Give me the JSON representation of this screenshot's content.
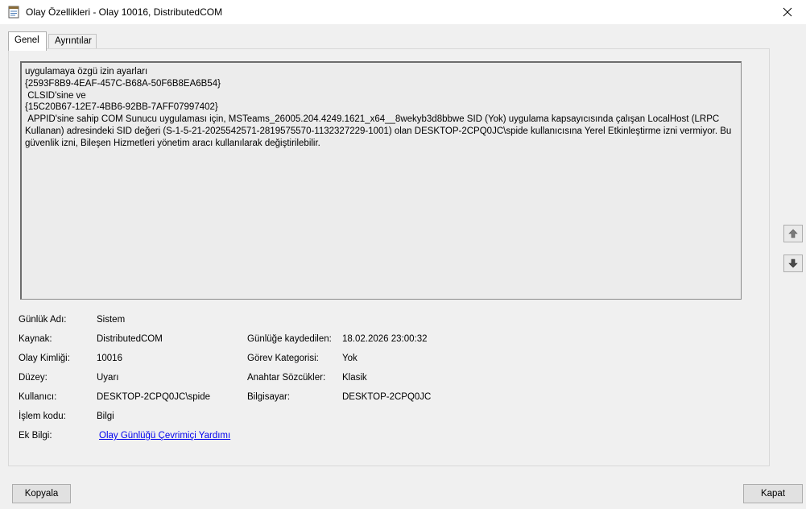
{
  "window": {
    "title": "Olay Özellikleri - Olay 10016, DistributedCOM"
  },
  "tabs": [
    {
      "label": "Genel"
    },
    {
      "label": "Ayrıntılar"
    }
  ],
  "description": {
    "lines": [
      "uygulamaya özgü izin ayarları",
      "{2593F8B9-4EAF-457C-B68A-50F6B8EA6B54}",
      " CLSID'sine ve",
      "{15C20B67-12E7-4BB6-92BB-7AFF07997402}",
      " APPID'sine sahip COM Sunucu uygulaması için, MSTeams_26005.204.4249.1621_x64__8wekyb3d8bbwe SID (Yok) uygulama kapsayıcısında çalışan LocalHost (LRPC Kullanan) adresindeki SID değeri (S-1-5-21-2025542571-2819575570-1132327229-1001) olan DESKTOP-2CPQ0JC\\spide kullanıcısına Yerel Etkinleştirme izni vermiyor. Bu güvenlik izni, Bileşen Hizmetleri yönetim aracı kullanılarak değiştirilebilir."
    ]
  },
  "fields": {
    "log_name": {
      "label": "Günlük Adı:",
      "value": "Sistem"
    },
    "source": {
      "label": "Kaynak:",
      "value": "DistributedCOM"
    },
    "logged": {
      "label": "Günlüğe kaydedilen:",
      "value": "18.02.2026 23:00:32"
    },
    "event_id": {
      "label": "Olay Kimliği:",
      "value": "10016"
    },
    "task_category": {
      "label": "Görev Kategorisi:",
      "value": "Yok"
    },
    "level": {
      "label": "Düzey:",
      "value": "Uyarı"
    },
    "keywords": {
      "label": "Anahtar Sözcükler:",
      "value": "Klasik"
    },
    "user": {
      "label": "Kullanıcı:",
      "value": "DESKTOP-2CPQ0JC\\spide"
    },
    "computer": {
      "label": "Bilgisayar:",
      "value": "DESKTOP-2CPQ0JC"
    },
    "opcode": {
      "label": "İşlem kodu:",
      "value": "Bilgi"
    },
    "more_info": {
      "label": "Ek Bilgi:",
      "value": "Olay Günlüğü Çevrimiçi Yardımı"
    }
  },
  "buttons": {
    "copy": "Kopyala",
    "close": "Kapat"
  },
  "icons": {
    "app": "event-viewer-icon",
    "close": "close-icon",
    "up": "arrow-up-icon",
    "down": "arrow-down-icon"
  }
}
